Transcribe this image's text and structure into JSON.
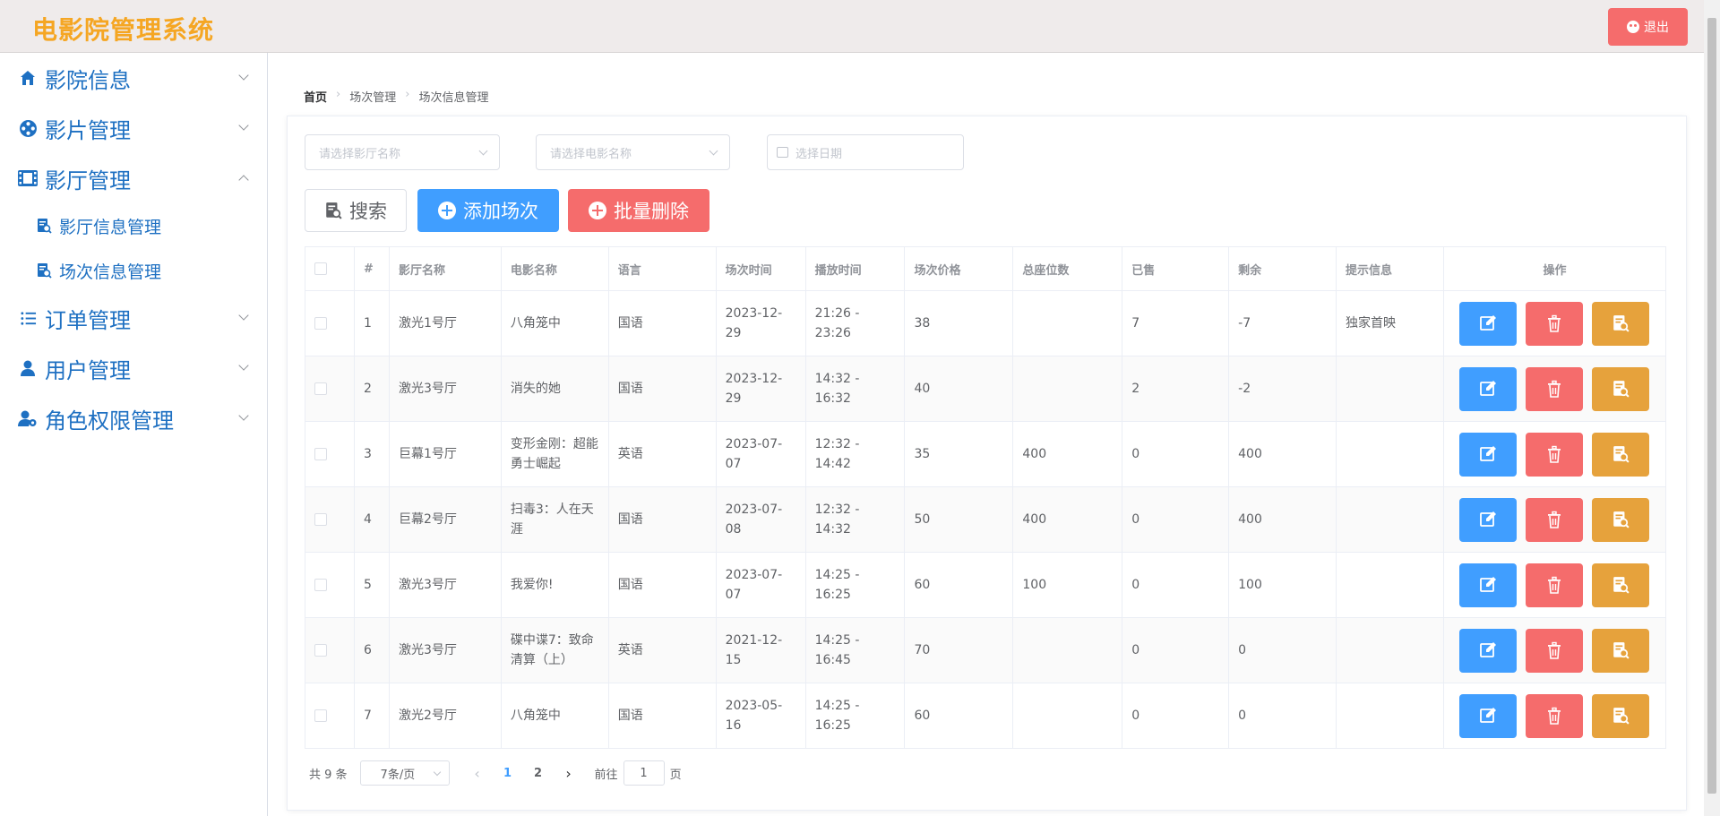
{
  "header": {
    "title": "电影院管理系统",
    "logout_label": "退出",
    "logout_color": "#f56c6c",
    "title_color": "#f5a623"
  },
  "sidebar": {
    "items": [
      {
        "label": "影院信息",
        "icon": "home-icon"
      },
      {
        "label": "影片管理",
        "icon": "film-reel-icon"
      },
      {
        "label": "影厅管理",
        "icon": "film-strip-icon",
        "expanded": true,
        "children": [
          {
            "label": "影厅信息管理",
            "icon": "document-search-icon"
          },
          {
            "label": "场次信息管理",
            "icon": "document-search-icon"
          }
        ]
      },
      {
        "label": "订单管理",
        "icon": "list-icon"
      },
      {
        "label": "用户管理",
        "icon": "user-icon"
      },
      {
        "label": "角色权限管理",
        "icon": "user-settings-icon"
      }
    ]
  },
  "breadcrumb": [
    "首页",
    "场次管理",
    "场次信息管理"
  ],
  "filters": {
    "hall_placeholder": "请选择影厅名称",
    "movie_placeholder": "请选择电影名称",
    "date_placeholder": "选择日期"
  },
  "toolbar": {
    "search_label": "搜索",
    "add_label": "添加场次",
    "batch_delete_label": "批量删除"
  },
  "table": {
    "headers": [
      "#",
      "影厅名称",
      "电影名称",
      "语言",
      "场次时间",
      "播放时间",
      "场次价格",
      "总座位数",
      "已售",
      "剩余",
      "提示信息",
      "操作"
    ],
    "rows": [
      [
        "1",
        "激光1号厅",
        "八角笼中",
        "国语",
        "2023-12-29",
        "21:26 - 23:26",
        "38",
        "",
        "7",
        "-7",
        "独家首映"
      ],
      [
        "2",
        "激光3号厅",
        "消失的她",
        "国语",
        "2023-12-29",
        "14:32 - 16:32",
        "40",
        "",
        "2",
        "-2",
        ""
      ],
      [
        "3",
        "巨幕1号厅",
        "变形金刚：超能勇士崛起",
        "英语",
        "2023-07-07",
        "12:32 - 14:42",
        "35",
        "400",
        "0",
        "400",
        ""
      ],
      [
        "4",
        "巨幕2号厅",
        "扫毒3：人在天涯",
        "国语",
        "2023-07-08",
        "12:32 - 14:32",
        "50",
        "400",
        "0",
        "400",
        ""
      ],
      [
        "5",
        "激光3号厅",
        "我爱你!",
        "国语",
        "2023-07-07",
        "14:25 - 16:25",
        "60",
        "100",
        "0",
        "100",
        ""
      ],
      [
        "6",
        "激光3号厅",
        "碟中谍7：致命清算（上）",
        "英语",
        "2021-12-15",
        "14:25 - 16:45",
        "70",
        "",
        "0",
        "0",
        ""
      ],
      [
        "7",
        "激光2号厅",
        "八角笼中",
        "国语",
        "2023-05-16",
        "14:25 - 16:25",
        "60",
        "",
        "0",
        "0",
        ""
      ]
    ]
  },
  "pagination": {
    "total_text": "共 9 条",
    "page_size": "7条/页",
    "pages": [
      "1",
      "2"
    ],
    "current_page": "1",
    "goto_prefix": "前往",
    "goto_value": "1",
    "goto_suffix": "页"
  }
}
